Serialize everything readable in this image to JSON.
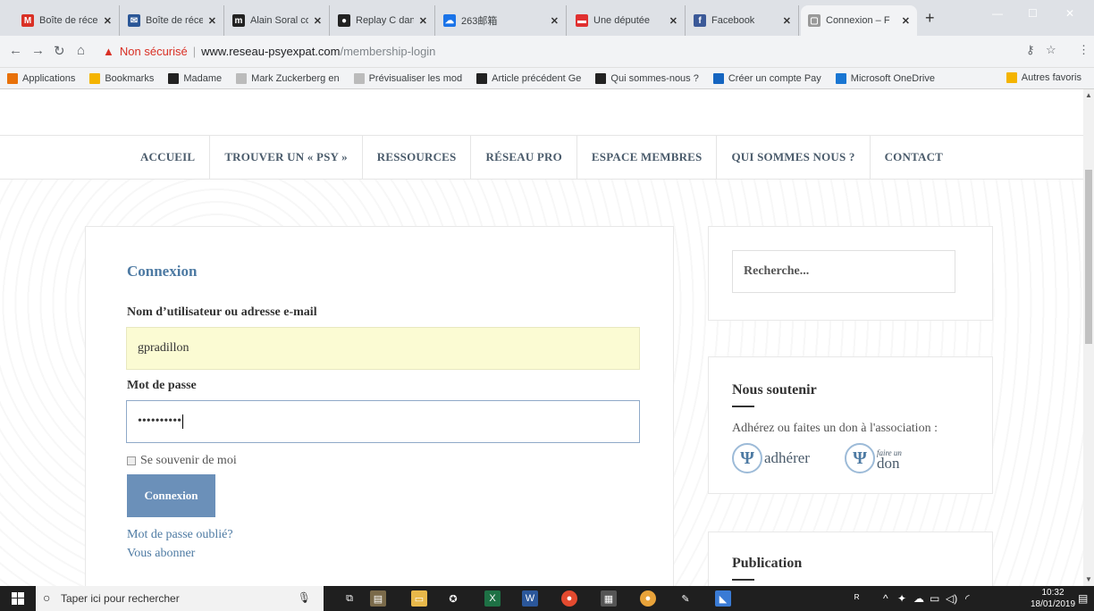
{
  "browser": {
    "tabs": [
      {
        "title": "Boîte de récep",
        "icon": "gmail-icon",
        "color": "#d93025",
        "glyph": "M"
      },
      {
        "title": "Boîte de récep",
        "icon": "mail-icon",
        "color": "#2b5797",
        "glyph": "✉"
      },
      {
        "title": "Alain Soral con",
        "icon": "site-icon",
        "color": "#222",
        "glyph": "m"
      },
      {
        "title": "Replay C dans",
        "icon": "tv-icon",
        "color": "#222",
        "glyph": "●"
      },
      {
        "title": "263邮箱",
        "icon": "mail-cloud-icon",
        "color": "#1a73e8",
        "glyph": "☁"
      },
      {
        "title": "Une députée",
        "icon": "news-icon",
        "color": "#e03030",
        "glyph": "▬"
      },
      {
        "title": "Facebook",
        "icon": "facebook-icon",
        "color": "#3b5998",
        "glyph": "f"
      },
      {
        "title": "Connexion – F",
        "icon": "page-icon",
        "color": "#999",
        "glyph": "▢"
      }
    ],
    "not_secure": "Non sécurisé",
    "url_host": "www.reseau-psyexpat.com",
    "url_path": "/membership-login",
    "bookmarks": [
      {
        "label": "Applications",
        "icon": "apps-icon",
        "color": "#e8710a"
      },
      {
        "label": "Bookmarks",
        "icon": "folder-icon",
        "color": "#f4b400"
      },
      {
        "label": "Madame",
        "icon": "site-icon",
        "color": "#222"
      },
      {
        "label": "Mark Zuckerberg en",
        "icon": "page-icon",
        "color": "#bbb"
      },
      {
        "label": "Prévisualiser les mod",
        "icon": "page-icon",
        "color": "#bbb"
      },
      {
        "label": "Article précédent Ge",
        "icon": "site-icon",
        "color": "#222"
      },
      {
        "label": "Qui sommes-nous ?",
        "icon": "site-icon",
        "color": "#222"
      },
      {
        "label": "Créer un compte Pay",
        "icon": "paypal-icon",
        "color": "#1565c0"
      },
      {
        "label": "Microsoft OneDrive",
        "icon": "onedrive-icon",
        "color": "#1976d2"
      }
    ],
    "other_bookmarks": "Autres favoris"
  },
  "nav": {
    "items": [
      "ACCUEIL",
      "TROUVER UN « PSY »",
      "RESSOURCES",
      "RÉSEAU PRO",
      "ESPACE MEMBRES",
      "QUI SOMMES NOUS ?",
      "CONTACT"
    ]
  },
  "login": {
    "title": "Connexion",
    "username_label": "Nom d’utilisateur ou adresse e-mail",
    "username_value": "gpradillon",
    "password_label": "Mot de passe",
    "password_value": "••••••••••",
    "remember_label": "Se souvenir de moi",
    "submit_label": "Connexion",
    "forgot_link": "Mot de passe oublié?",
    "subscribe_link": "Vous abonner"
  },
  "sidebar": {
    "search_placeholder": "Recherche...",
    "support_title": "Nous soutenir",
    "support_text": "Adhérez ou faites un don à l'association :",
    "adherer_label": "adhérer",
    "don_small": "faire un",
    "don_label": "don",
    "publication_title": "Publication"
  },
  "taskbar": {
    "search_text": "Taper ici pour rechercher",
    "time": "10:32",
    "date": "18/01/2019"
  }
}
